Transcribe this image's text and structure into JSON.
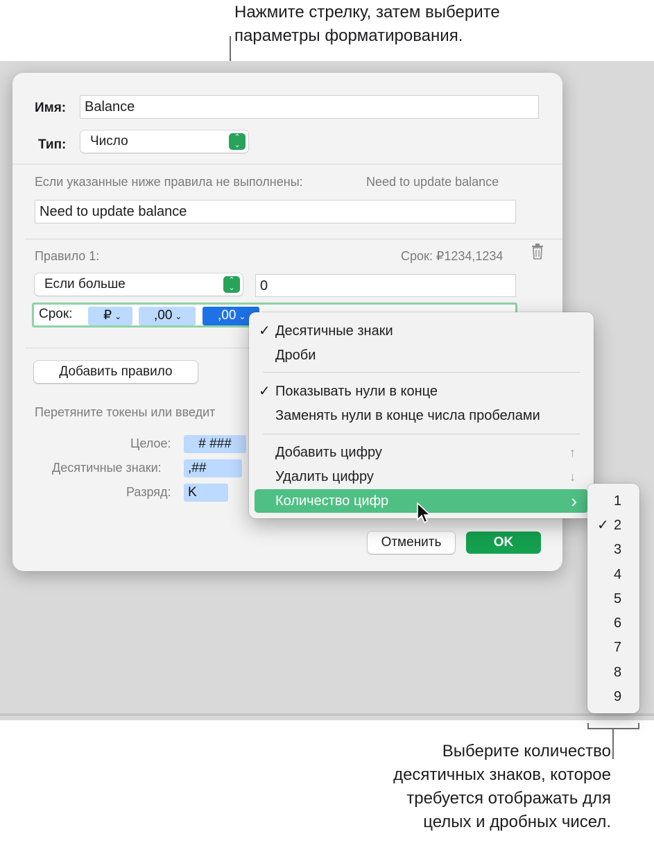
{
  "callouts": {
    "top": [
      "Нажмите стрелку, затем выберите",
      "параметры форматирования."
    ],
    "bottom": [
      "Выберите количество",
      "десятичных знаков, которое",
      "требуется отображать для",
      "целых и дробных чисел."
    ]
  },
  "dialog": {
    "name_label": "Имя:",
    "name_value": "Balance",
    "type_label": "Тип:",
    "type_value": "Число",
    "fallback_label": "Если указанные ниже правила не выполнены:",
    "fallback_preview": "Need to update balance",
    "fallback_value": "Need to update balance",
    "rule_label": "Правило 1:",
    "rule_preview": "Срок: ₽1234,1234",
    "rule_condition": "Если больше",
    "rule_value": "0",
    "format_label": "Срок:",
    "tokens": [
      "₽",
      ",00",
      ",00"
    ],
    "add_rule_button": "Добавить правило",
    "drag_hint": "Перетяните токены или введит",
    "legend": [
      {
        "label": "Целое:",
        "token": "# ###"
      },
      {
        "label": "Десятичные знаки:",
        "token": ",##"
      },
      {
        "label": "Разряд:",
        "token": "K"
      }
    ],
    "cancel_button": "Отменить",
    "ok_button": "OK"
  },
  "menu": {
    "items": [
      {
        "label": "Десятичные знаки",
        "checked": true
      },
      {
        "label": "Дроби",
        "checked": false
      },
      {
        "label": "Показывать нули в конце",
        "checked": true
      },
      {
        "label": "Заменять нули в конце числа пробелами",
        "checked": false
      },
      {
        "label": "Добавить цифру",
        "shortcut": "↑"
      },
      {
        "label": "Удалить цифру",
        "shortcut": "↓"
      },
      {
        "label": "Количество цифр",
        "submenu_arrow": "›"
      }
    ],
    "checkmark": "✓"
  },
  "submenu": {
    "items": [
      "1",
      "2",
      "3",
      "4",
      "5",
      "6",
      "7",
      "8",
      "9"
    ],
    "selected": "2"
  },
  "colors": {
    "accent_green": "#14a04f",
    "highlight_green": "#4fbf84",
    "token_blue": "#bcd9ff",
    "token_selected": "#1e72e6"
  }
}
